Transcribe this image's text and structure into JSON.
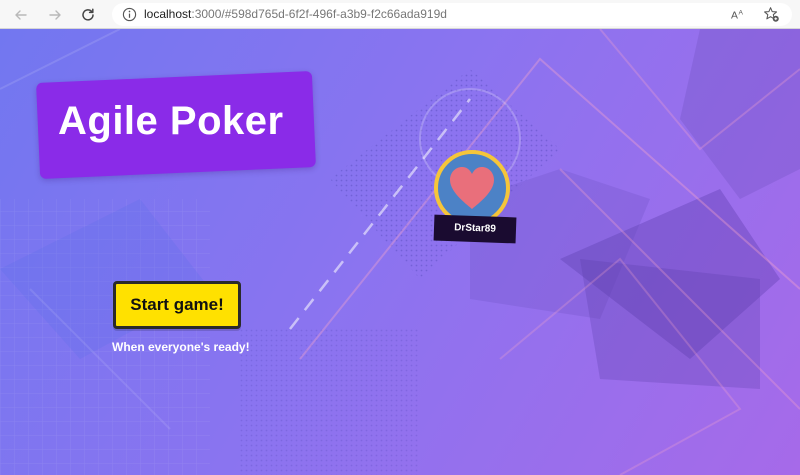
{
  "browser": {
    "url_host": "localhost",
    "url_path": ":3000/#598d765d-6f2f-496f-a3b9-f2c66ada919d",
    "icons": [
      "back-arrow-icon",
      "forward-arrow-icon",
      "reload-icon",
      "info-icon",
      "read-aloud-icon",
      "favorites-icon"
    ]
  },
  "app": {
    "title": "Agile Poker"
  },
  "players": [
    {
      "name": "DrStar89",
      "avatar_icon": "heart-icon"
    }
  ],
  "actions": {
    "start_label": "Start game!",
    "start_hint": "When everyone's ready!"
  },
  "colors": {
    "title_card": "#8a2be8",
    "start_button": "#ffe100",
    "avatar_ring": "#f5c53a",
    "avatar_fill": "#4c82c6",
    "heart": "#e96f7b",
    "name_tag": "#1a0b30"
  }
}
